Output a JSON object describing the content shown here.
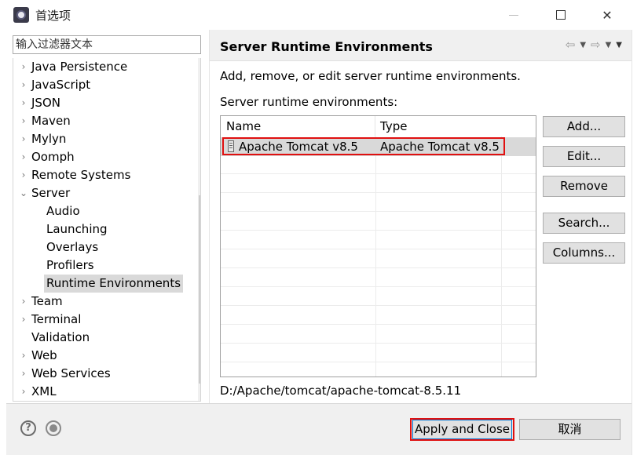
{
  "window": {
    "title": "首选项",
    "close_glyph": "✕"
  },
  "sidebar": {
    "filter_placeholder": "输入过滤器文本",
    "items": [
      {
        "label": "Java Persistence",
        "chevron": "›",
        "level": 0
      },
      {
        "label": "JavaScript",
        "chevron": "›",
        "level": 0
      },
      {
        "label": "JSON",
        "chevron": "›",
        "level": 0
      },
      {
        "label": "Maven",
        "chevron": "›",
        "level": 0
      },
      {
        "label": "Mylyn",
        "chevron": "›",
        "level": 0
      },
      {
        "label": "Oomph",
        "chevron": "›",
        "level": 0
      },
      {
        "label": "Remote Systems",
        "chevron": "›",
        "level": 0
      },
      {
        "label": "Server",
        "chevron": "⌄",
        "level": 0,
        "expanded": true
      },
      {
        "label": "Audio",
        "chevron": "",
        "level": 1
      },
      {
        "label": "Launching",
        "chevron": "",
        "level": 1
      },
      {
        "label": "Overlays",
        "chevron": "",
        "level": 1
      },
      {
        "label": "Profilers",
        "chevron": "",
        "level": 1
      },
      {
        "label": "Runtime Environments",
        "chevron": "",
        "level": 1,
        "selected": true
      },
      {
        "label": "Team",
        "chevron": "›",
        "level": 0
      },
      {
        "label": "Terminal",
        "chevron": "›",
        "level": 0
      },
      {
        "label": "Validation",
        "chevron": "",
        "level": 0
      },
      {
        "label": "Web",
        "chevron": "›",
        "level": 0
      },
      {
        "label": "Web Services",
        "chevron": "›",
        "level": 0
      },
      {
        "label": "XML",
        "chevron": "›",
        "level": 0
      }
    ]
  },
  "page": {
    "title": "Server Runtime Environments",
    "nav": {
      "back": "⇦",
      "forward": "⇨",
      "dropdown": "▼",
      "menu": "▼"
    },
    "description": "Add, remove, or edit server runtime environments.",
    "env_label": "Server runtime environments:",
    "table": {
      "columns": [
        "Name",
        "Type"
      ],
      "rows": [
        {
          "name": "Apache Tomcat v8.5",
          "type": "Apache Tomcat v8.5"
        }
      ]
    },
    "buttons": {
      "add": "Add...",
      "edit": "Edit...",
      "remove": "Remove",
      "search": "Search...",
      "columns": "Columns..."
    },
    "path": "D:/Apache/tomcat/apache-tomcat-8.5.11"
  },
  "footer": {
    "help_glyph": "?",
    "apply_close": "Apply and Close",
    "cancel": "取消"
  },
  "colors": {
    "highlight": "#e01010",
    "selection": "#d9d9d9",
    "button_bg": "#e1e1e1",
    "focus_blue": "#0078d7"
  }
}
